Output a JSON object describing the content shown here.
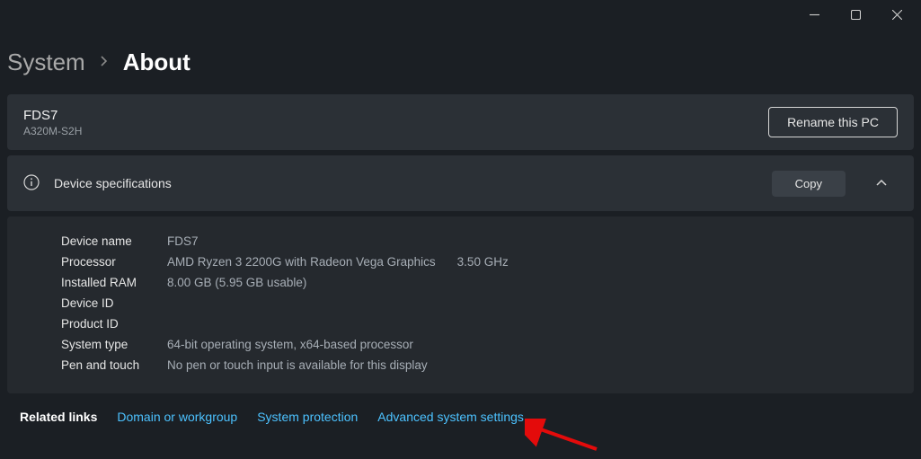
{
  "breadcrumb": {
    "parent": "System",
    "current": "About"
  },
  "pc": {
    "name": "FDS7",
    "model": "A320M-S2H",
    "rename_label": "Rename this PC"
  },
  "spec_header": {
    "title": "Device specifications",
    "copy_label": "Copy"
  },
  "specs": {
    "device_name_label": "Device name",
    "device_name_value": "FDS7",
    "processor_label": "Processor",
    "processor_value": "AMD Ryzen 3 2200G with Radeon Vega Graphics",
    "processor_speed": "3.50 GHz",
    "ram_label": "Installed RAM",
    "ram_value": "8.00 GB (5.95 GB usable)",
    "device_id_label": "Device ID",
    "device_id_value": "",
    "product_id_label": "Product ID",
    "product_id_value": "",
    "system_type_label": "System type",
    "system_type_value": "64-bit operating system, x64-based processor",
    "pen_touch_label": "Pen and touch",
    "pen_touch_value": "No pen or touch input is available for this display"
  },
  "related": {
    "title": "Related links",
    "links": {
      "domain": "Domain or workgroup",
      "protection": "System protection",
      "advanced": "Advanced system settings"
    }
  }
}
